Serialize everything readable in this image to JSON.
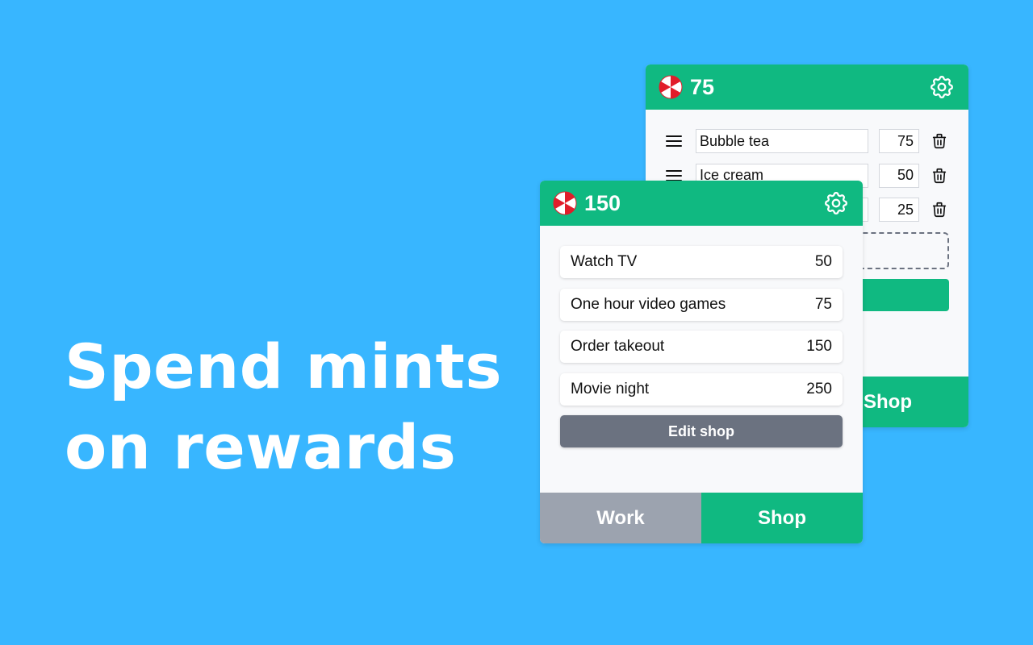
{
  "headline": {
    "line1": "Spend mints",
    "line2": "on rewards"
  },
  "back_panel": {
    "balance": "75",
    "items": [
      {
        "name": "Bubble tea",
        "price": "75"
      },
      {
        "name": "Ice cream",
        "price": "50"
      },
      {
        "name": "",
        "price": "25"
      }
    ],
    "tab_shop": "Shop"
  },
  "front_panel": {
    "balance": "150",
    "items": [
      {
        "name": "Watch TV",
        "price": "50"
      },
      {
        "name": "One hour video games",
        "price": "75"
      },
      {
        "name": "Order takeout",
        "price": "150"
      },
      {
        "name": "Movie night",
        "price": "250"
      }
    ],
    "edit_shop_label": "Edit shop",
    "tab_work": "Work",
    "tab_shop": "Shop"
  },
  "colors": {
    "background": "#38b6ff",
    "accent_green": "#10b981",
    "tab_inactive": "#9ca3af",
    "button_gray": "#6b7280",
    "mint_red": "#e11d2a"
  },
  "icons": {
    "mint": "peppermint-candy-icon",
    "settings": "gear-icon",
    "drag": "drag-handle-icon",
    "delete": "trash-icon"
  }
}
